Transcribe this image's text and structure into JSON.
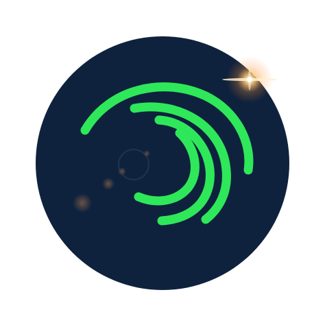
{
  "logo": {
    "icon_name": "alight-motion-swirl-icon",
    "colors": {
      "page_background": "#ffffff",
      "disc": "#0f223d",
      "arc_green": "#2ee85a",
      "flare": "#ffc36e",
      "bokeh": "#8a5a3a"
    }
  }
}
